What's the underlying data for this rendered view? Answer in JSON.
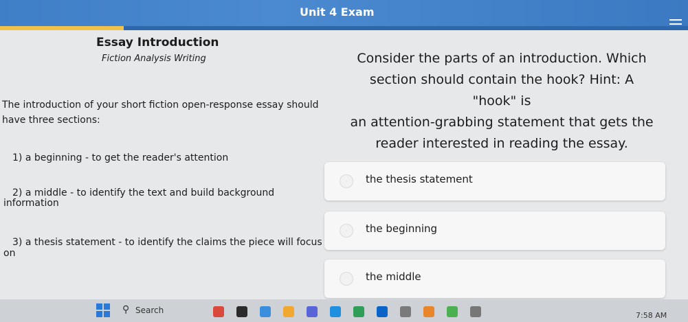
{
  "header": {
    "title": "Unit 4 Exam",
    "progress_fraction": 0.18
  },
  "passage": {
    "title": "Essay Introduction",
    "subtitle": "Fiction Analysis Writing",
    "intro_line1": "The introduction of your short fiction open-response essay should",
    "intro_line2": "have three sections:",
    "item1": "1) a beginning - to get the reader's attention",
    "item2_line1": "2) a middle - to identify the text and build background",
    "item2_line2": "information",
    "item3_line1": "3) a thesis statement - to identify the claims the piece will focus",
    "item3_line2": "on"
  },
  "question": {
    "line1": "Consider the parts of an introduction. Which",
    "line2": "section should contain the hook? Hint: A \"hook\" is",
    "line3": "an attention-grabbing statement that gets the",
    "line4": "reader interested in reading the essay."
  },
  "options": [
    {
      "label": "the thesis statement"
    },
    {
      "label": "the beginning"
    },
    {
      "label": "the middle"
    }
  ],
  "taskbar": {
    "search_placeholder": "Search",
    "clock": "7:58 AM",
    "icon_colors": [
      "#d94a3c",
      "#2b2b2b",
      "#3a8fdc",
      "#f0a830",
      "#5865d8",
      "#1f8fe0",
      "#2f9e58",
      "#0a64c8",
      "#7a7a7a",
      "#e8862c",
      "#4caf50",
      "#777777"
    ]
  }
}
